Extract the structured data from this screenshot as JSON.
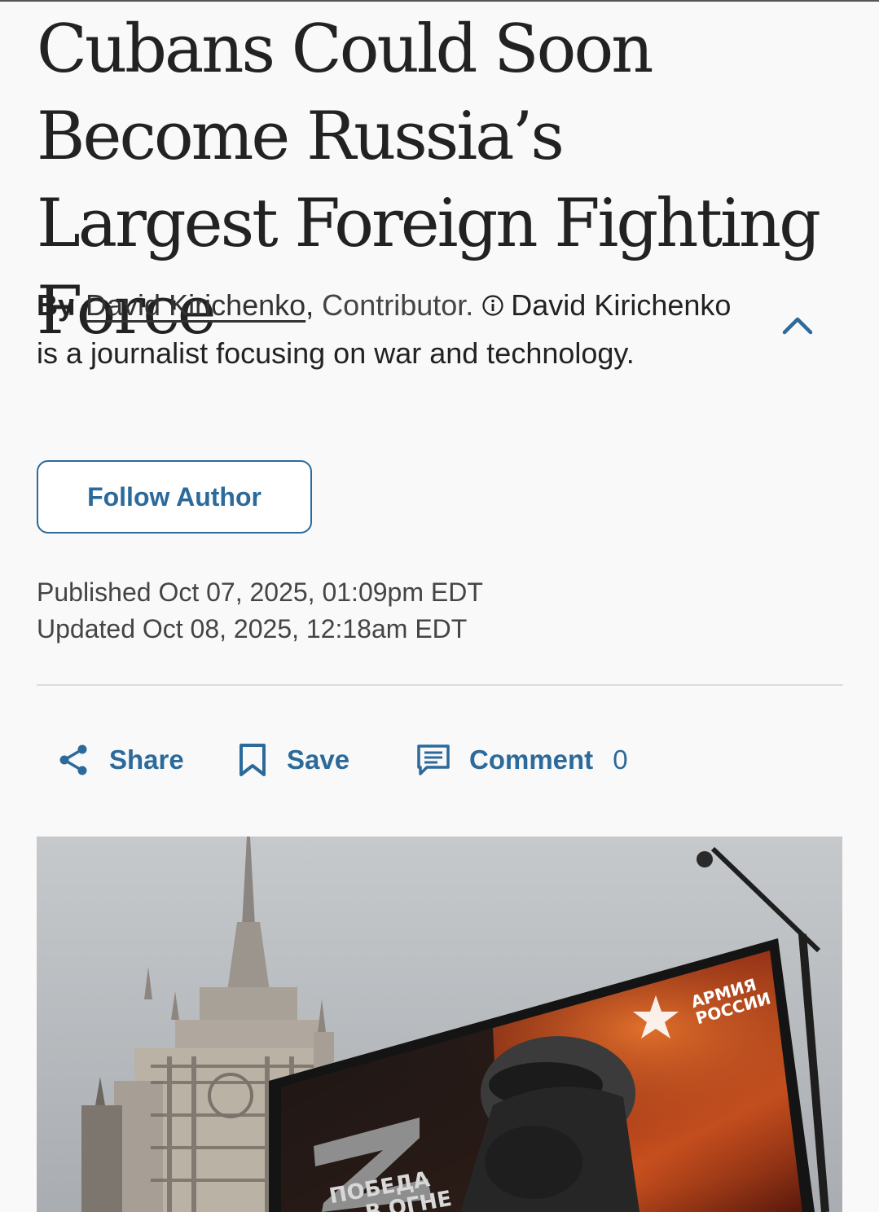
{
  "article": {
    "headline": "Cubans Could Soon Become Russia’s Largest Foreign Fighting Force",
    "byline_prefix": "By",
    "author_name": "David Kirichenko",
    "author_role": "Contributor.",
    "author_bio": "David Kirichenko is a journalist focusing on war and technology.",
    "follow_label": "Follow Author",
    "published": "Published Oct 07, 2025, 01:09pm EDT",
    "updated": "Updated Oct 08, 2025, 12:18am EDT"
  },
  "actions": {
    "share_label": "Share",
    "save_label": "Save",
    "comment_label": "Comment",
    "comment_count": "0"
  },
  "hero_image": {
    "billboard_brand": [
      "АРМИЯ",
      "РОССИИ"
    ],
    "billboard_slogan": [
      "ПОБЕДА",
      "В ОГНЕ"
    ]
  },
  "colors": {
    "accent": "#2b6a9a",
    "background": "#f9f9f9",
    "text": "#222222"
  },
  "icons": [
    "info-icon",
    "chevron-up-icon",
    "share-icon",
    "bookmark-icon",
    "comment-icon"
  ]
}
